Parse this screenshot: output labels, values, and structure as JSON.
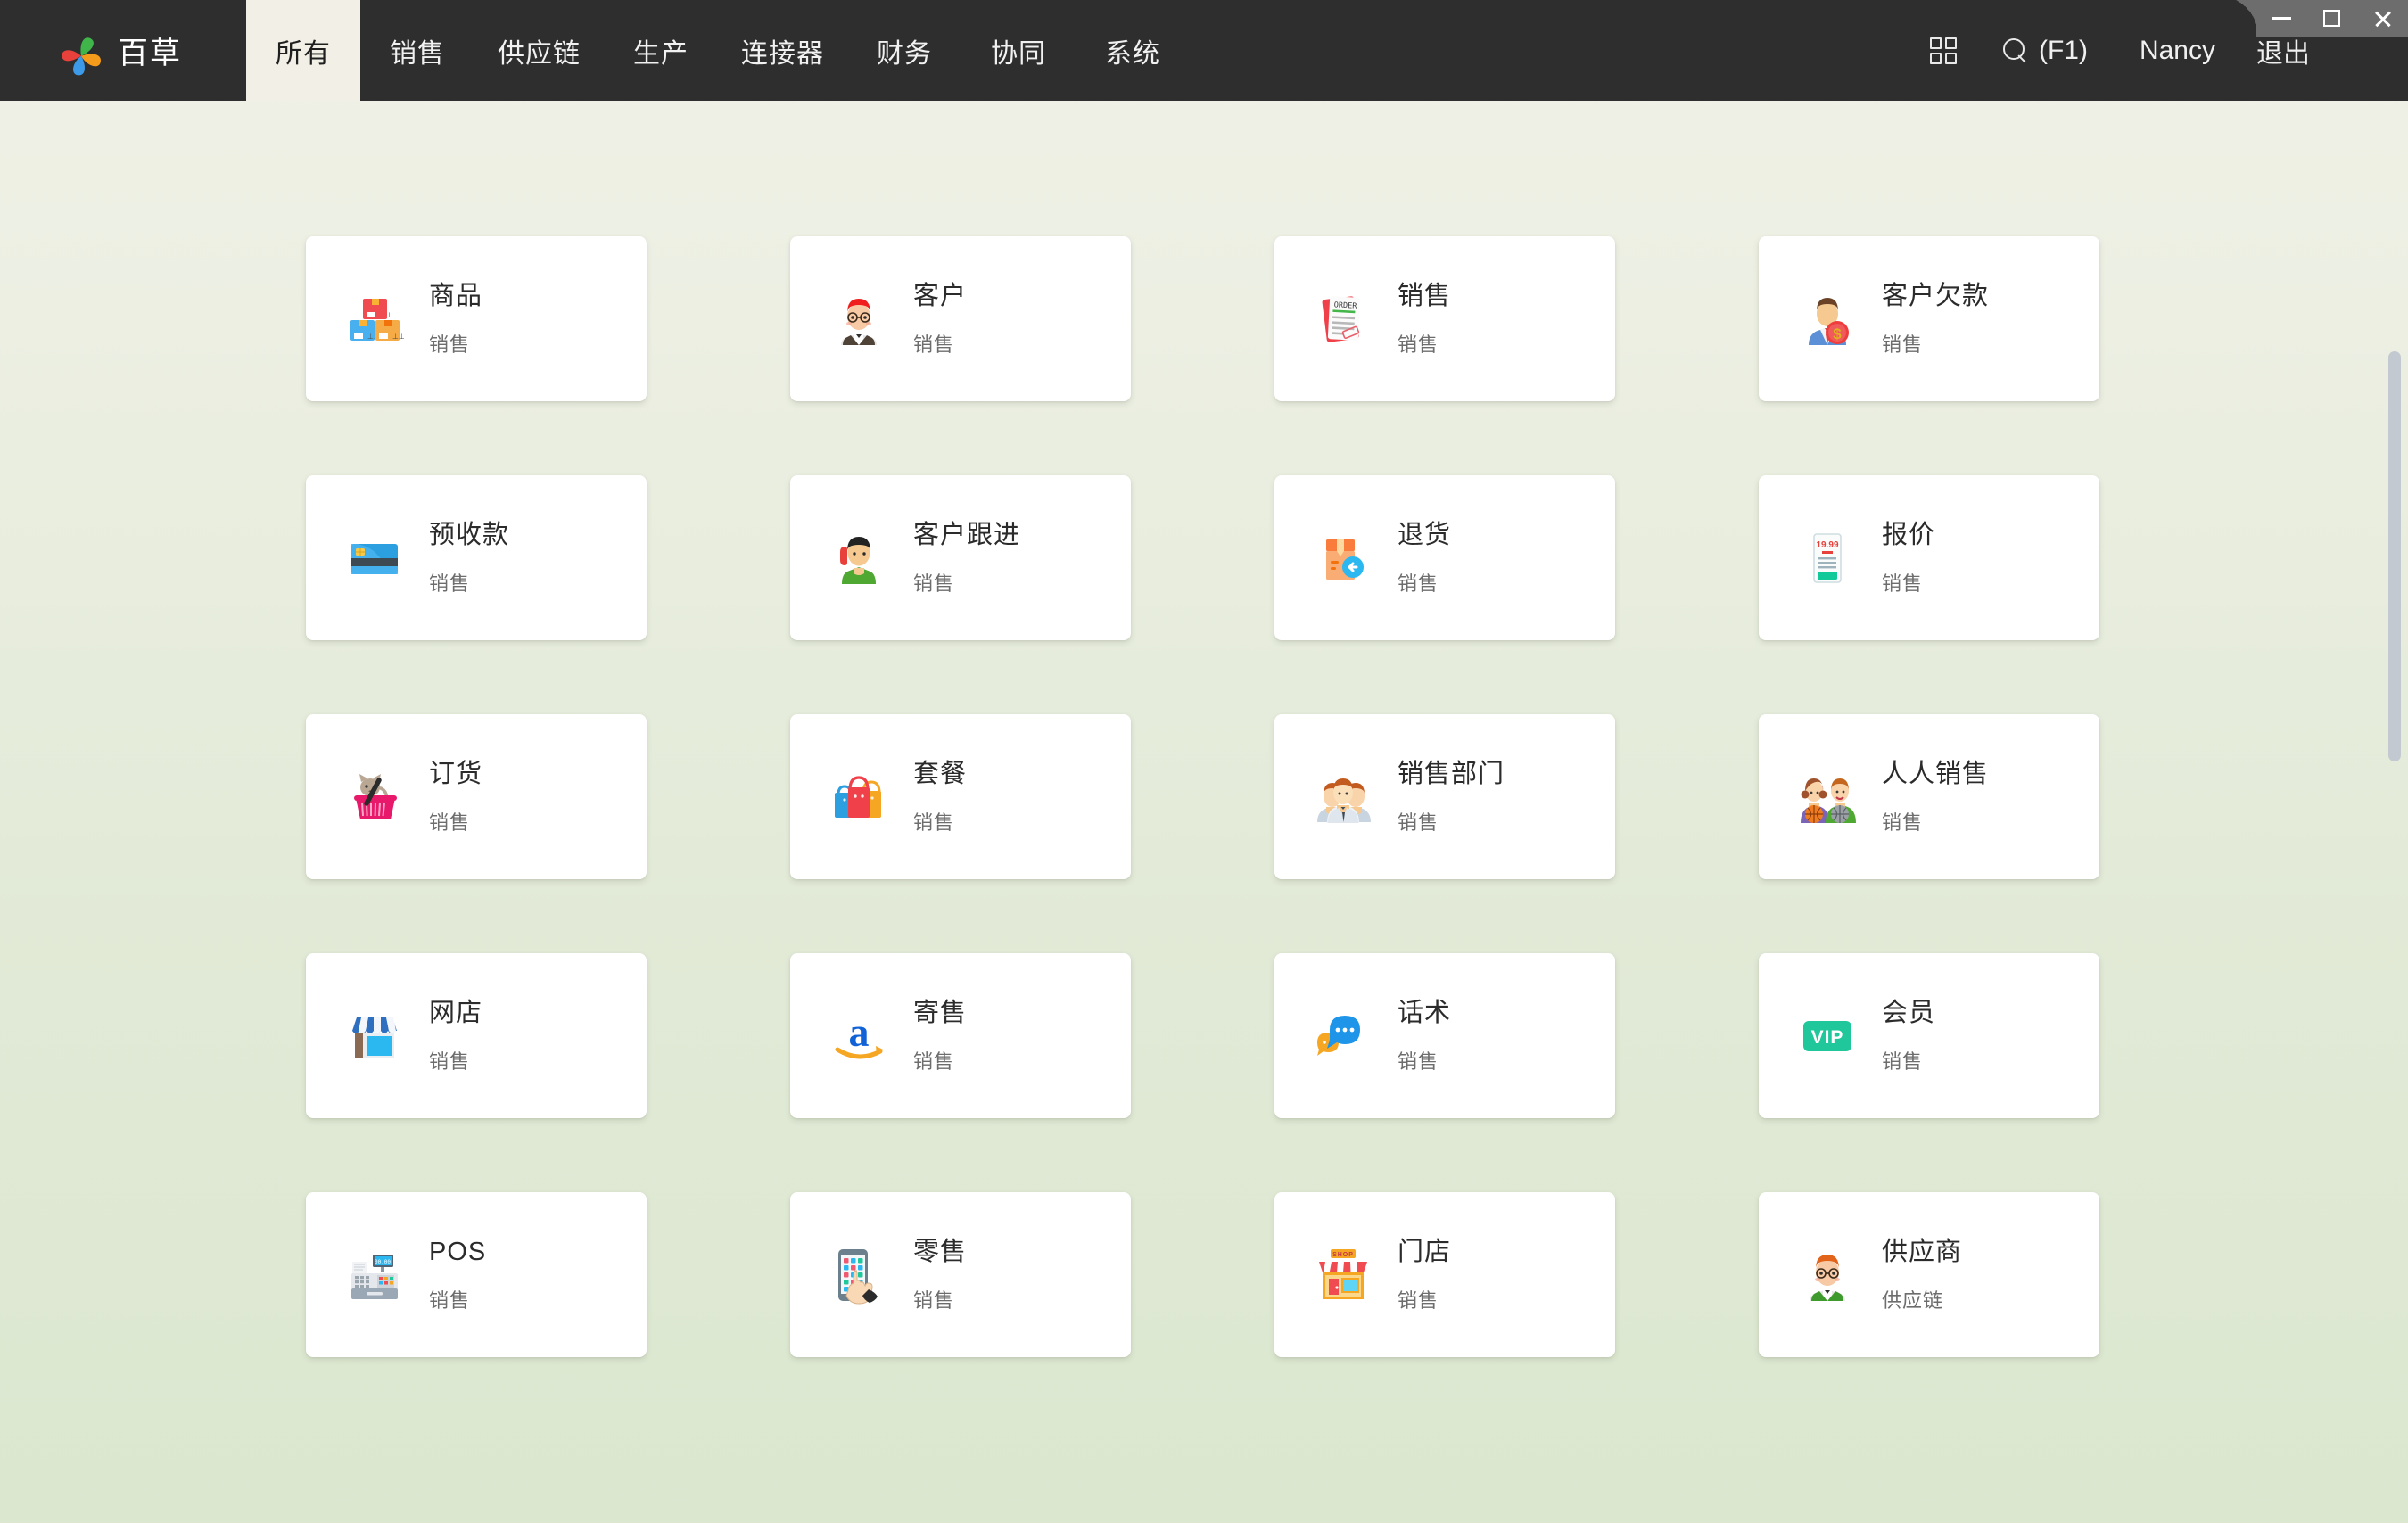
{
  "window": {
    "controls": [
      {
        "name": "minimize",
        "glyph": "−"
      },
      {
        "name": "maximize",
        "glyph": "□"
      },
      {
        "name": "close",
        "glyph": "✕"
      }
    ]
  },
  "header": {
    "brand_name": "百草",
    "brand_logo_icon": "pinwheel-logo-icon",
    "background_color": "#2e2e2e",
    "active_tab_background": "#f2f0e6",
    "tabs": [
      {
        "label": "所有",
        "active": true
      },
      {
        "label": "销售",
        "active": false
      },
      {
        "label": "供应链",
        "active": false
      },
      {
        "label": "生产",
        "active": false
      },
      {
        "label": "连接器",
        "active": false
      },
      {
        "label": "财务",
        "active": false
      },
      {
        "label": "协同",
        "active": false
      },
      {
        "label": "系统",
        "active": false
      }
    ],
    "right": {
      "grid_icon": "grid-view-icon",
      "search_icon": "search-icon",
      "search_label": "(F1)",
      "user_name": "Nancy",
      "logout_label": "退出"
    }
  },
  "main": {
    "background_gradient_from": "#f0f1e7",
    "background_gradient_to": "#dbe7cf",
    "cards": [
      {
        "title": "商品",
        "category": "销售",
        "icon": "boxes-icon"
      },
      {
        "title": "客户",
        "category": "销售",
        "icon": "customer-person-icon"
      },
      {
        "title": "销售",
        "category": "销售",
        "icon": "order-document-icon"
      },
      {
        "title": "客户欠款",
        "category": "销售",
        "icon": "businessman-dollar-icon"
      },
      {
        "title": "预收款",
        "category": "销售",
        "icon": "credit-card-icon"
      },
      {
        "title": "客户跟进",
        "category": "销售",
        "icon": "person-phone-call-icon"
      },
      {
        "title": "退货",
        "category": "销售",
        "icon": "return-box-arrow-icon"
      },
      {
        "title": "报价",
        "category": "销售",
        "icon": "price-tag-icon",
        "icon_text": "19.99"
      },
      {
        "title": "订货",
        "category": "销售",
        "icon": "cat-in-basket-icon"
      },
      {
        "title": "套餐",
        "category": "销售",
        "icon": "shopping-bags-icon"
      },
      {
        "title": "销售部门",
        "category": "销售",
        "icon": "people-group-icon"
      },
      {
        "title": "人人销售",
        "category": "销售",
        "icon": "two-people-basketball-icon"
      },
      {
        "title": "网店",
        "category": "销售",
        "icon": "online-store-icon"
      },
      {
        "title": "寄售",
        "category": "销售",
        "icon": "amazon-a-icon"
      },
      {
        "title": "话术",
        "category": "销售",
        "icon": "chat-bubbles-icon"
      },
      {
        "title": "会员",
        "category": "销售",
        "icon": "vip-badge-icon",
        "icon_text": "VIP"
      },
      {
        "title": "POS",
        "category": "销售",
        "icon": "cash-register-icon"
      },
      {
        "title": "零售",
        "category": "销售",
        "icon": "phone-tap-icon"
      },
      {
        "title": "门店",
        "category": "销售",
        "icon": "shop-storefront-icon",
        "icon_text": "SHOP"
      },
      {
        "title": "供应商",
        "category": "供应链",
        "icon": "supplier-person-icon"
      }
    ]
  },
  "scrollbar": {
    "orientation": "vertical",
    "thumb_color": "#c3c9d0"
  }
}
